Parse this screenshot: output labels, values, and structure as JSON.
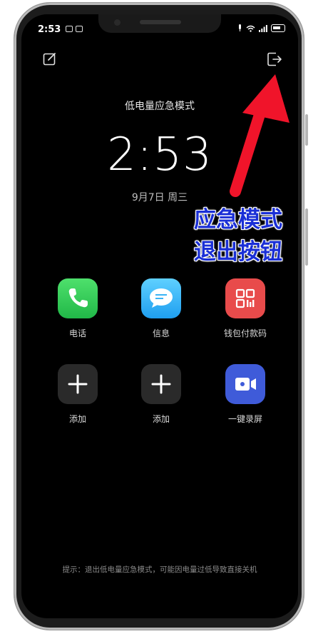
{
  "status_bar": {
    "time": "2:53"
  },
  "mode_title": "低电量应急模式",
  "clock": "2:53",
  "date": "9月7日 周三",
  "apps": [
    {
      "label": "电话",
      "icon": "phone-icon"
    },
    {
      "label": "信息",
      "icon": "message-icon"
    },
    {
      "label": "钱包付款码",
      "icon": "qr-code-icon"
    },
    {
      "label": "添加",
      "icon": "plus-icon"
    },
    {
      "label": "添加",
      "icon": "plus-icon"
    },
    {
      "label": "一键录屏",
      "icon": "screen-record-icon"
    }
  ],
  "hint": "提示：退出低电量应急模式，可能因电量过低导致直接关机",
  "annotation": {
    "line1": "应急模式",
    "line2": "退出按钮",
    "color": "#1a2fd6"
  },
  "arrow_color": "#f0142a"
}
